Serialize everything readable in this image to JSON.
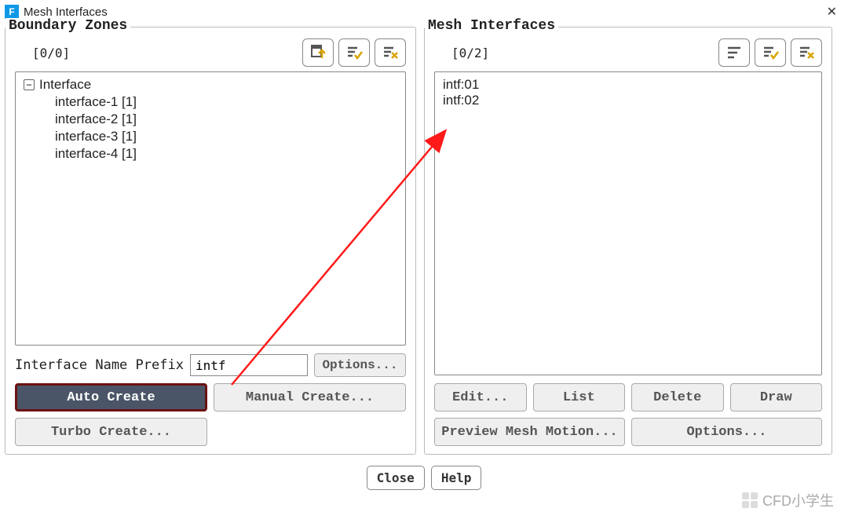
{
  "window": {
    "title": "Mesh Interfaces",
    "icon_letter": "F"
  },
  "left": {
    "title": "Boundary Zones",
    "counter": "[0/0]",
    "tree_root": "Interface",
    "tree_children": [
      "interface-1  [1]",
      "interface-2  [1]",
      "interface-3  [1]",
      "interface-4  [1]"
    ],
    "prefix_label": "Interface Name Prefix",
    "prefix_value": "intf",
    "options_btn": "Options...",
    "auto_create": "Auto Create",
    "manual_create": "Manual Create...",
    "turbo_create": "Turbo Create..."
  },
  "right": {
    "title": "Mesh Interfaces",
    "counter": "[0/2]",
    "items": [
      "intf:01",
      "intf:02"
    ],
    "edit_btn": "Edit...",
    "list_btn": "List",
    "delete_btn": "Delete",
    "draw_btn": "Draw",
    "preview_btn": "Preview Mesh Motion...",
    "options_btn": "Options..."
  },
  "bottom": {
    "close": "Close",
    "help": "Help"
  },
  "watermark": "CFD小学生"
}
